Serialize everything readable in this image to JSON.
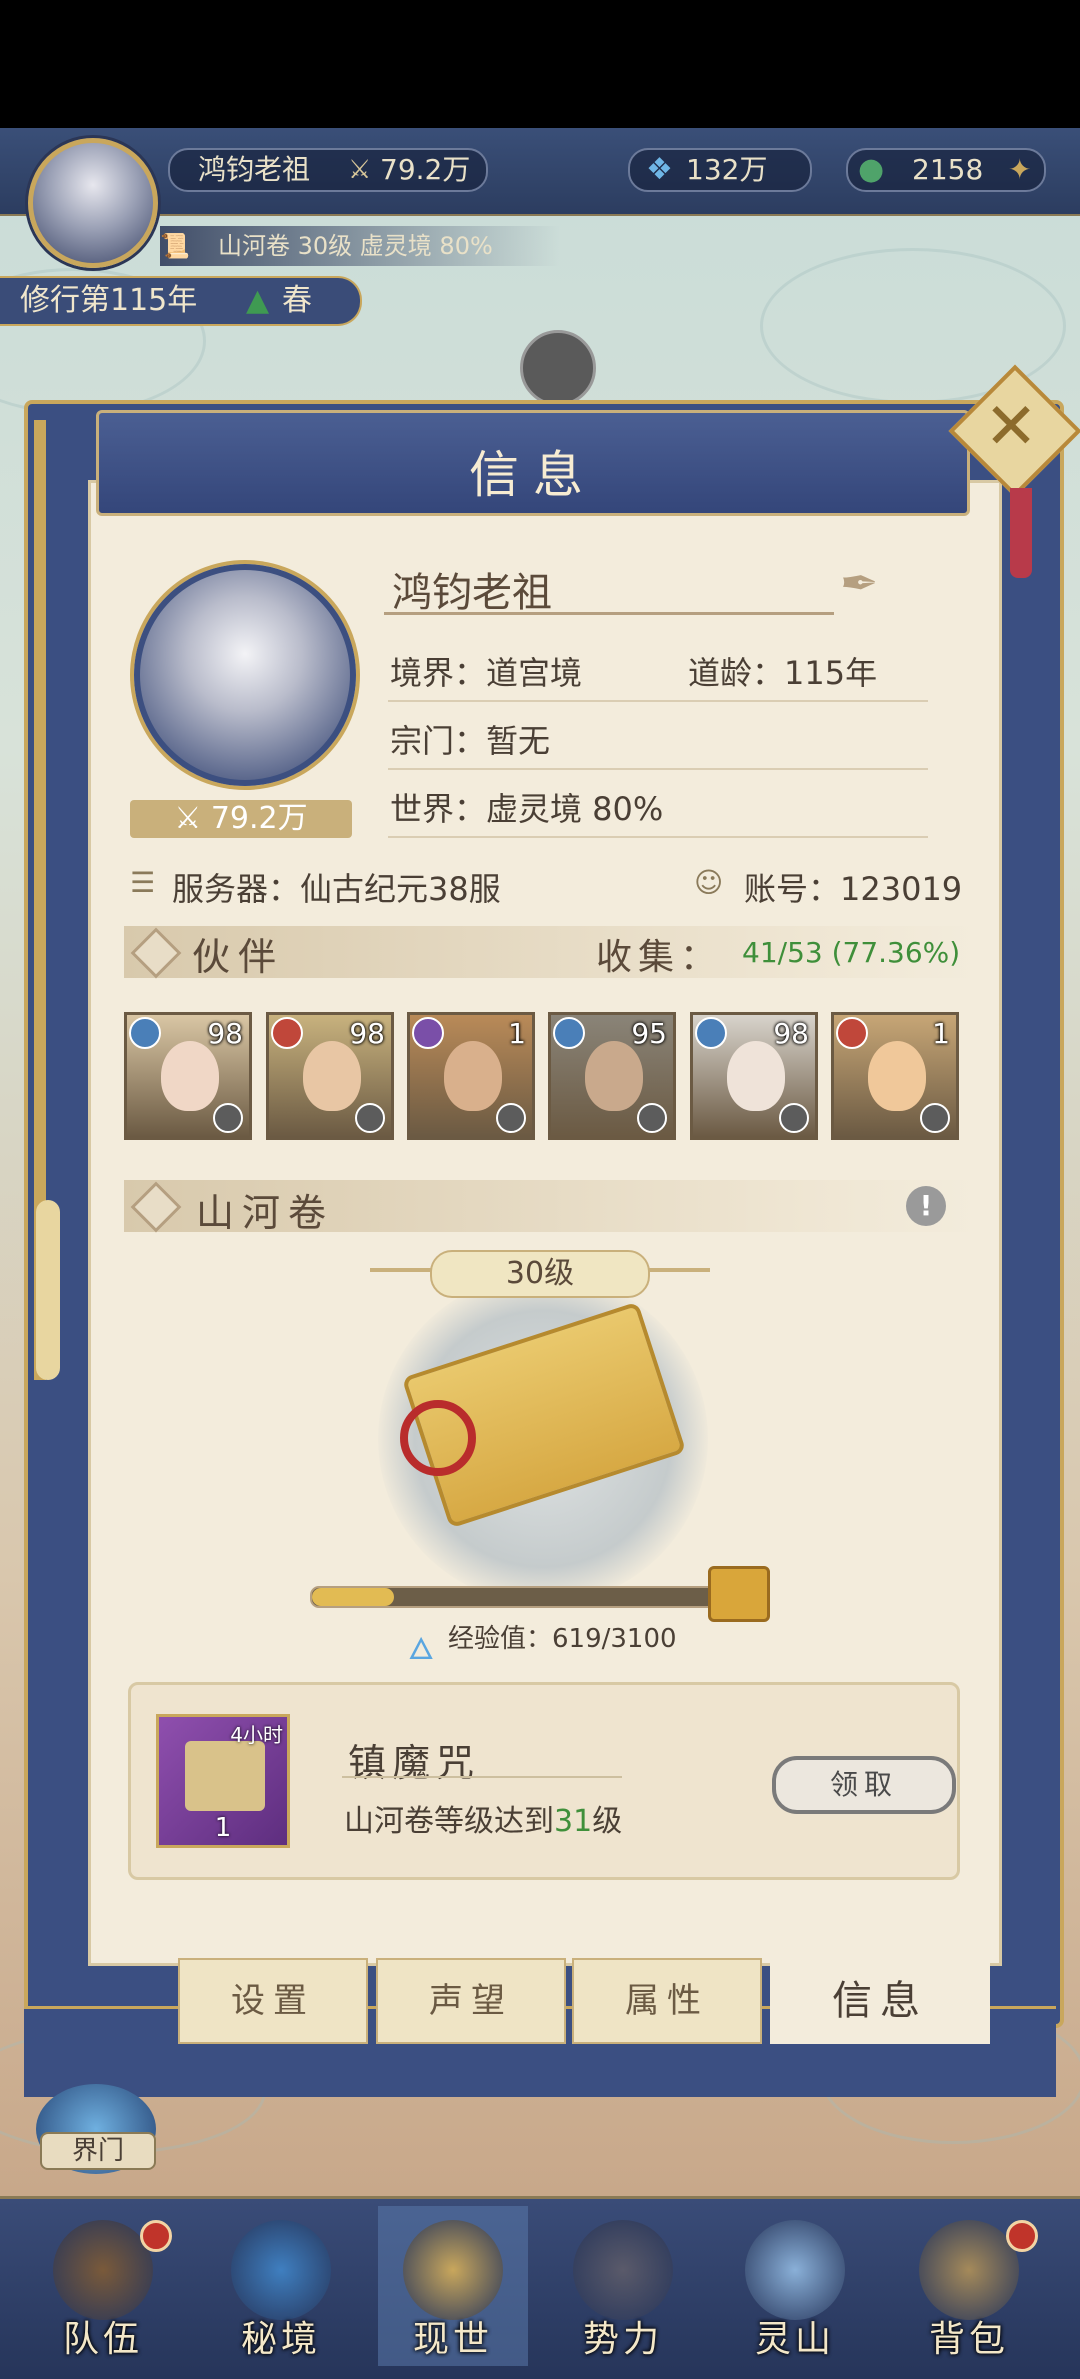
{
  "hud": {
    "player_name": "鸿钧老祖",
    "power": "79.2万",
    "spirit_stones": "132万",
    "jade": "2158",
    "scroll_status": "山河卷 30级 虚灵境 80%",
    "cultivation_year": "修行第115年",
    "season": "春"
  },
  "modal": {
    "title": "信息",
    "name": "鸿钧老祖",
    "realm_label": "境界：道宫境",
    "age_label": "道龄：115年",
    "sect_label": "宗门：暂无",
    "world_label": "世界：虚灵境  80%",
    "power_badge": "79.2万",
    "server_label": "服务器：仙古纪元38服",
    "account_label": "账号：123019",
    "partners": {
      "title": "伙伴",
      "collect_label": "收集：",
      "collect_value": "41/53 (77.36%)",
      "cards": [
        {
          "level": "98",
          "element": "water",
          "color": "#4a7fb8",
          "bg": "#d9c6a4",
          "face": "#f0d7c6"
        },
        {
          "level": "98",
          "element": "fire",
          "color": "#c0473a",
          "bg": "#c8b27e",
          "face": "#e8c6a4"
        },
        {
          "level": "1",
          "element": "dark",
          "color": "#7a4fa8",
          "bg": "#b98a58",
          "face": "#d9b08c"
        },
        {
          "level": "95",
          "element": "water",
          "color": "#4a7fb8",
          "bg": "#8a8478",
          "face": "#c9a98c"
        },
        {
          "level": "98",
          "element": "water",
          "color": "#4a7fb8",
          "bg": "#d8d4cc",
          "face": "#efe3d9"
        },
        {
          "level": "1",
          "element": "fire",
          "color": "#c0473a",
          "bg": "#c7a676",
          "face": "#f0c89a"
        }
      ]
    },
    "scroll": {
      "title": "山河卷",
      "level": "30级",
      "exp_label": "经验值：619/3100",
      "exp_fraction": 0.2
    },
    "reward": {
      "name": "镇魔咒",
      "duration": "4小时",
      "count": "1",
      "desc_prefix": "山河卷等级达到",
      "desc_level": "31",
      "desc_suffix": "级",
      "claim": "领取"
    },
    "tabs": [
      "设置",
      "声望",
      "属性",
      "信息"
    ]
  },
  "side": {
    "gate_label": "界门"
  },
  "nav": [
    "队伍",
    "秘境",
    "现世",
    "势力",
    "灵山",
    "背包"
  ]
}
